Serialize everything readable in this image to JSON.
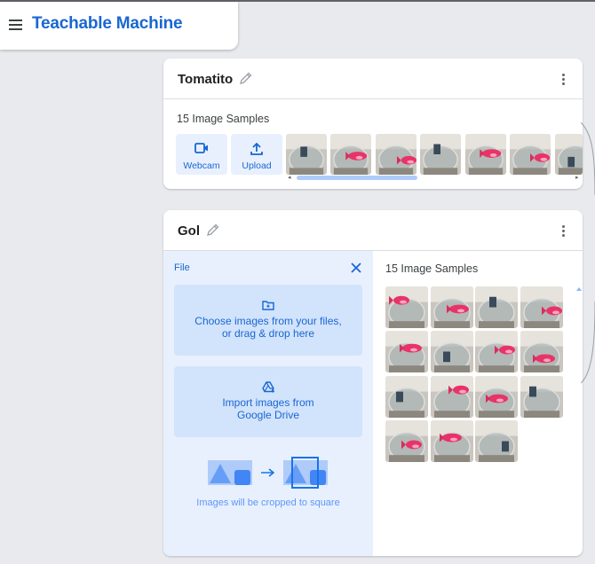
{
  "app": {
    "title": "Teachable Machine",
    "menu_icon": "hamburger-menu-icon",
    "accent": "#1967d2",
    "light_accent": "#e8f0fe"
  },
  "classes": [
    {
      "name": "Tomatito",
      "edit_icon": "pencil-icon",
      "more_icon": "more-vert-icon",
      "sample_count_label": "15 Image Samples",
      "sources": [
        {
          "label": "Webcam",
          "icon": "webcam-icon"
        },
        {
          "label": "Upload",
          "icon": "upload-icon"
        }
      ],
      "visible_thumbnails": 7
    },
    {
      "name": "Gol",
      "edit_icon": "pencil-icon",
      "more_icon": "more-vert-icon",
      "sample_count_label": "15 Image Samples",
      "file_panel": {
        "title": "File",
        "close_icon": "close-icon",
        "choose_files": {
          "line1": "Choose images from your files,",
          "line2": "or drag & drop here",
          "icon": "folder-add-icon"
        },
        "drive": {
          "line1": "Import images from",
          "line2": "Google Drive",
          "icon": "google-drive-icon"
        },
        "crop_note": "Images will be cropped to square"
      },
      "visible_thumbnails": 15
    }
  ]
}
